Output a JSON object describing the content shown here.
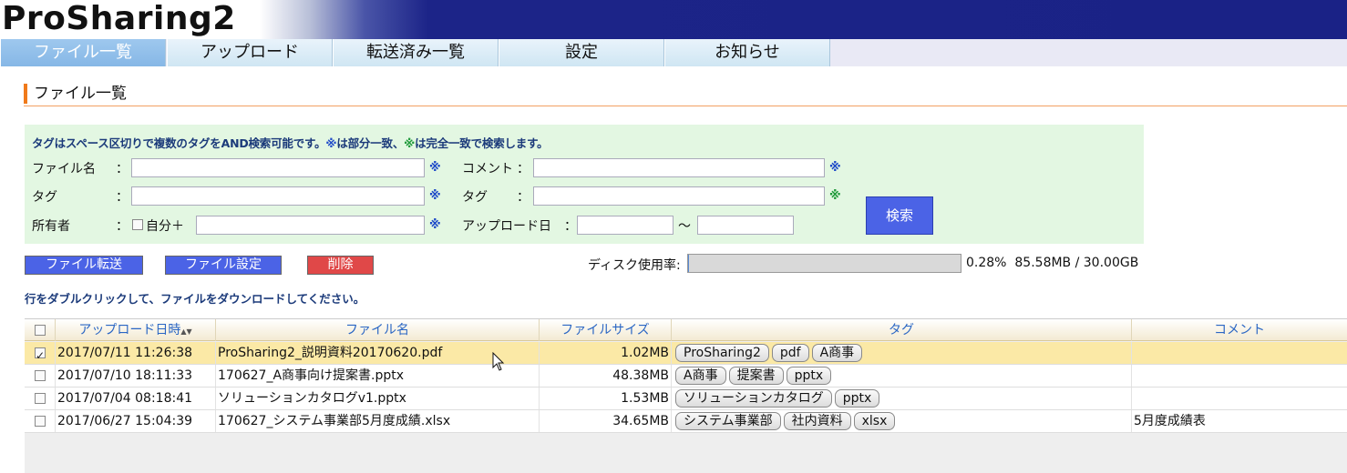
{
  "app": {
    "logo": "ProSharing2"
  },
  "nav": {
    "tabs": [
      {
        "label": "ファイル一覧",
        "active": true
      },
      {
        "label": "アップロード",
        "active": false
      },
      {
        "label": "転送済み一覧",
        "active": false
      },
      {
        "label": "設定",
        "active": false
      },
      {
        "label": "お知らせ",
        "active": false
      }
    ]
  },
  "page": {
    "title": "ファイル一覧"
  },
  "search": {
    "note_a": "タグはスペース区切りで複数のタグをAND検索可能です。",
    "note_mark_partial": "※",
    "note_b": "は部分一致、",
    "note_mark_exact": "※",
    "note_c": "は完全一致で検索します。",
    "colon": "：",
    "mark": "※",
    "filename_label": "ファイル名",
    "tag_label": "タグ",
    "owner_label": "所有者",
    "owner_self_label": "自分＋",
    "comment_label": "コメント",
    "tag2_label": "タグ",
    "upload_date_label": "アップロード日",
    "date_sep": "〜",
    "search_button": "検索",
    "filename_value": "",
    "tag_value": "",
    "owner_value": "",
    "comment_value": "",
    "tag2_value": "",
    "date_from": "",
    "date_to": ""
  },
  "actions": {
    "transfer_button": "ファイル転送",
    "settings_button": "ファイル設定",
    "delete_button": "削除"
  },
  "disk": {
    "label": "ディスク使用率:",
    "percent_text": "0.28%",
    "usage_text": "85.58MB / 30.00GB",
    "fraction": 0.0028
  },
  "hint": "行をダブルクリックして、ファイルをダウンロードしてください。",
  "table": {
    "columns": {
      "upload_date": "アップロード日時",
      "sort_icon": "▲▼",
      "filename": "ファイル名",
      "filesize": "ファイルサイズ",
      "tags": "タグ",
      "comment": "コメント"
    },
    "rows": [
      {
        "checked": true,
        "selected": true,
        "date": "2017/07/11 11:26:38",
        "name": "ProSharing2_説明資料20170620.pdf",
        "size": "1.02MB",
        "tags": [
          "ProSharing2",
          "pdf",
          "A商事"
        ],
        "comment": ""
      },
      {
        "checked": false,
        "selected": false,
        "date": "2017/07/10 18:11:33",
        "name": "170627_A商事向け提案書.pptx",
        "size": "48.38MB",
        "tags": [
          "A商事",
          "提案書",
          "pptx"
        ],
        "comment": ""
      },
      {
        "checked": false,
        "selected": false,
        "date": "2017/07/04 08:18:41",
        "name": "ソリューションカタログv1.pptx",
        "size": "1.53MB",
        "tags": [
          "ソリューションカタログ",
          "pptx"
        ],
        "comment": ""
      },
      {
        "checked": false,
        "selected": false,
        "date": "2017/06/27 15:04:39",
        "name": "170627_システム事業部5月度成績.xlsx",
        "size": "34.65MB",
        "tags": [
          "システム事業部",
          "社内資料",
          "xlsx"
        ],
        "comment": "5月度成績表"
      }
    ]
  },
  "colors": {
    "accent_blue": "#4b63e6",
    "delete_red": "#e04848",
    "selected_row": "#fbe9a6",
    "search_bg": "#e3f7e2"
  }
}
